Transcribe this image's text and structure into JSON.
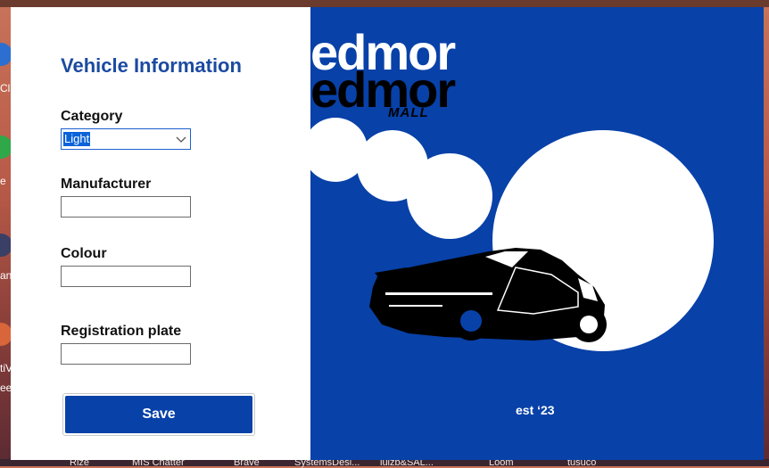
{
  "window": {
    "form": {
      "title": "Vehicle Information",
      "fields": [
        {
          "label": "Category",
          "value": "Light",
          "type": "select"
        },
        {
          "label": "Manufacturer",
          "value": "",
          "type": "text"
        },
        {
          "label": "Colour",
          "value": "",
          "type": "text"
        },
        {
          "label": "Registration plate",
          "value": "",
          "type": "text"
        }
      ],
      "save_label": "Save"
    },
    "poster": {
      "logo_line1": "edmor",
      "logo_line2": "edmor",
      "logo_sub": "MALL",
      "est": "est ‘23",
      "accent_color": "#0841a8"
    }
  },
  "desktop": {
    "left_labels": [
      "Cli",
      "e",
      "an",
      "tiV",
      "ee"
    ],
    "taskbar_labels": [
      "Rize",
      "MIS Chatter",
      "Brave",
      "SystemsDesi...",
      "luizb&SAL...",
      "Loom",
      "tusuco"
    ]
  }
}
